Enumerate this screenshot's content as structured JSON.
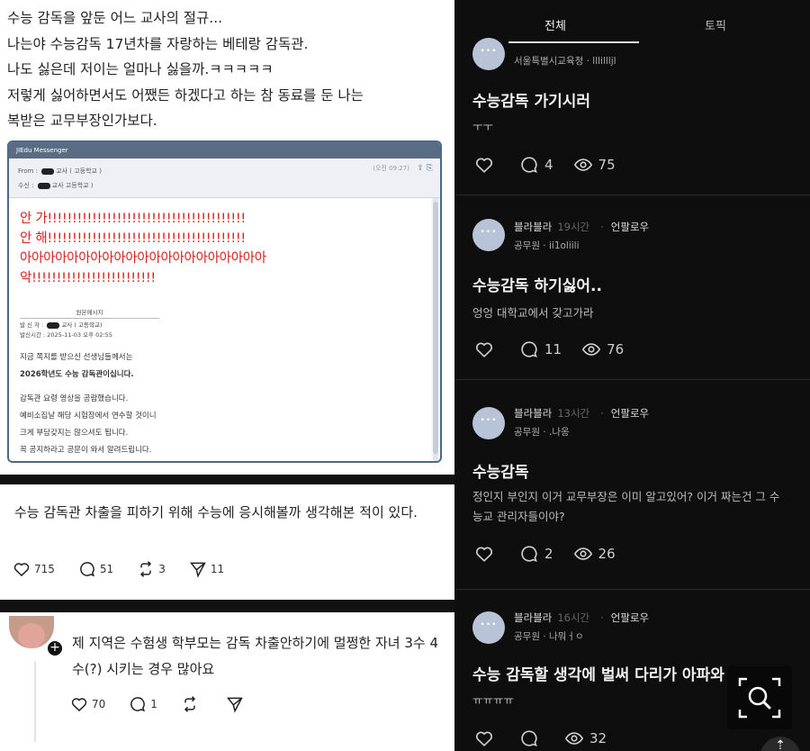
{
  "left": {
    "intro_lines": [
      "수능 감독을 앞둔 어느 교사의 절규...",
      "나는야 수능감독 17년차를 자랑하는 베테랑 감독관.",
      "나도 싫은데 저이는 얼마나 싫을까.ㅋㅋㅋㅋㅋ",
      "저렇게 싫어하면서도 어쨌든 하겠다고 하는 참 동료를 둔 나는",
      "복받은 교무부장인가보다."
    ],
    "messenger": {
      "app_title": "JIEdu Messenger",
      "from_label": "From : ",
      "from_value": "교사 (   고등학교 )",
      "to_label": "수신 : ",
      "to_value": "교사    고등학교 )",
      "date": "(오전 09:27)",
      "red_lines": [
        "안 가!!!!!!!!!!!!!!!!!!!!!!!!!!!!!!!!!!!!!!!!",
        "안 해!!!!!!!!!!!!!!!!!!!!!!!!!!!!!!!!!!!!!!!!",
        "아아아아아아아아아아아아아아아아아아아아아",
        "악!!!!!!!!!!!!!!!!!!!!!!!!!"
      ],
      "original_header": "원본메시지",
      "original_from": "발 신 자 : ",
      "original_from_value": "교사 (   고등학교)",
      "original_time": "발신시간 : 2025-11-03 오후 02:55",
      "notice_lines": [
        "지금 쪽지를 받으신 선생님들께서는",
        "2026학년도 수능 감독관이십니다.",
        "",
        "감독관 요령 영상을 공람했습니다.",
        "예비소집날 해당 시험장에서 연수할 것이니",
        "크게 부담갖지는 않으셔도 됩니다.",
        "꼭 공지하라고 공문이 와서 알려드립니다."
      ]
    },
    "post2": {
      "text": "수능 감독관 차출을 피하기 위해 수능에 응시해볼까 생각해본 적이 있다.",
      "likes": "715",
      "comments": "51",
      "reposts": "3",
      "shares": "11"
    },
    "post3": {
      "text": "제 지역은 수험생 학부모는 감독 차출안하기에 멀쩡한 자녀 3수 4수(?) 시키는 경우 많아요",
      "likes": "70",
      "comments": "1"
    }
  },
  "right": {
    "tabs": [
      "전체",
      "토픽"
    ],
    "posts": [
      {
        "author": "",
        "time": "",
        "follow": "",
        "org": "서울특별시교육청 · lllillljl",
        "title": "수능감독 가기시러",
        "body": "ㅜㅜ",
        "comments": "4",
        "views": "75"
      },
      {
        "author": "블라블라",
        "time": "19시간",
        "follow": "언팔로우",
        "org": "공무원 · ii1oliili",
        "title": "수능감독 하기싫어..",
        "body": "엉엉 대학교에서 갖고가라",
        "comments": "11",
        "views": "76"
      },
      {
        "author": "블라블라",
        "time": "13시간",
        "follow": "언팔로우",
        "org": "공무원 · .나옹",
        "title": "수능감독",
        "body": "정인지 부인지 이거 교무부장은 이미 알고있어? 이거 짜는건 그 수능교 관리자들이야?",
        "comments": "2",
        "views": "26"
      },
      {
        "author": "블라블라",
        "time": "16시간",
        "follow": "언팔로우",
        "org": "공무원 · 나뭐ㅓㅇ",
        "title": "수능 감독할 생각에 벌써 다리가 아파와",
        "body": "ㅠㅠㅠㅠ",
        "comments": "",
        "views": "32"
      }
    ]
  },
  "colors": {
    "red_text": "#d6241c",
    "dark_bg": "#0e0e0e",
    "avatar_blue": "#b9c3d8"
  }
}
